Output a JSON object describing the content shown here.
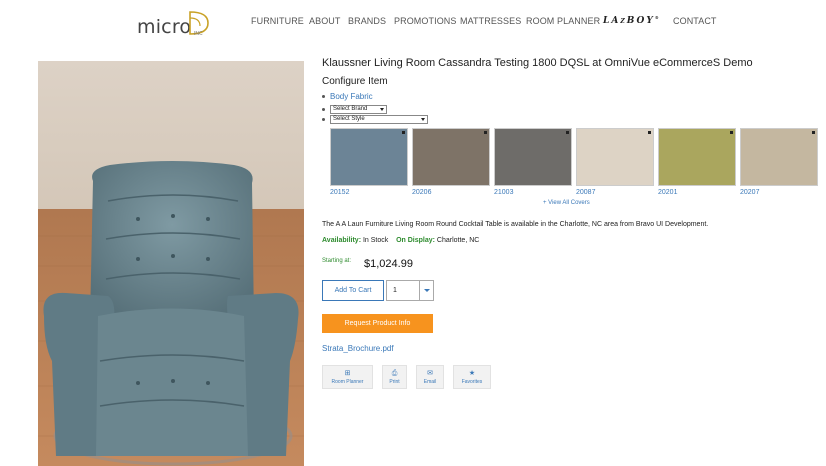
{
  "header": {
    "logo_text": "micro",
    "logo_inc": "INC",
    "nav": [
      {
        "label": "FURNITURE"
      },
      {
        "label": "ABOUT"
      },
      {
        "label": "BRANDS"
      },
      {
        "label": "PROMOTIONS"
      },
      {
        "label": "MATTRESSES"
      },
      {
        "label": "ROOM PLANNER"
      },
      {
        "label": "LA-Z-BOY"
      },
      {
        "label": "CONTACT"
      }
    ]
  },
  "product": {
    "title": "Klaussner Living Room Cassandra Testing 1800 DQSL at OmniVue eCommerceS Demo",
    "configure_heading": "Configure Item",
    "body_fabric_label": "Body Fabric",
    "select_brand": "Select Brand",
    "select_style": "Select Style",
    "swatches": [
      {
        "code": "20152",
        "color": "#6c8496"
      },
      {
        "code": "20206",
        "color": "#7e7367"
      },
      {
        "code": "21003",
        "color": "#6e6c69"
      },
      {
        "code": "20087",
        "color": "#ddd3c5"
      },
      {
        "code": "20201",
        "color": "#aaa65e"
      },
      {
        "code": "20207",
        "color": "#c4b7a0"
      }
    ],
    "view_all_covers": "+ View All Covers",
    "description": "The A A Laun Furniture Living Room Round Cocktail Table is available in the Charlotte, NC area from Bravo UI Development.",
    "availability_label": "Availability:",
    "availability_value": "In Stock",
    "on_display_label": "On Display:",
    "on_display_value": "Charlotte, NC",
    "starting_at_label": "Starting at:",
    "price": "$1,024.99",
    "add_to_cart": "Add To Cart",
    "quantity": "1",
    "request_info": "Request Product Info",
    "brochure_link": "Strata_Brochure.pdf",
    "actions": [
      {
        "label": "Room Planner",
        "icon": "plus-square-icon"
      },
      {
        "label": "Print",
        "icon": "print-icon"
      },
      {
        "label": "Email",
        "icon": "envelope-icon"
      },
      {
        "label": "Favorites",
        "icon": "star-icon"
      }
    ]
  },
  "colors": {
    "link": "#3a78b8",
    "accent_orange": "#f7931e",
    "availability_green": "#2e8b2e",
    "chair": "#6f8a93"
  }
}
